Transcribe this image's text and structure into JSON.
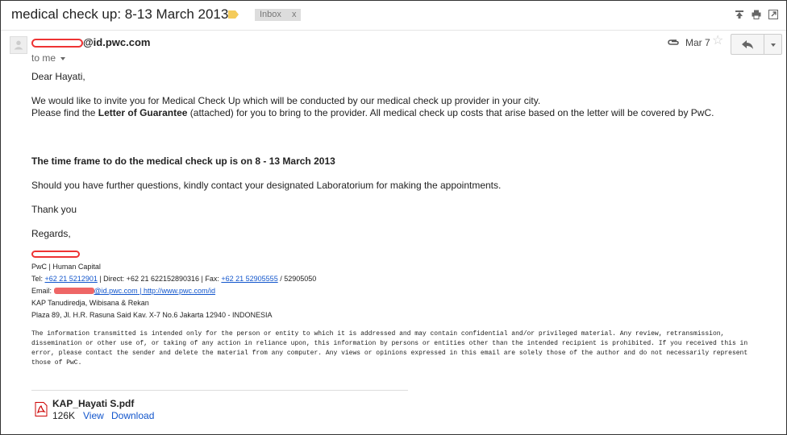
{
  "subject": "medical check up: 8-13 March 2013",
  "label_chip": {
    "text": "Inbox",
    "close": "x"
  },
  "sender": {
    "email_domain": "@id.pwc.com"
  },
  "to_me": "to me",
  "date": "Mar 7",
  "body": {
    "greeting": "Dear Hayati,",
    "para1_line1": "We would like to invite you for Medical Check Up which will be conducted by our medical check up provider in your city.",
    "para1_line2_pre": "Please find the ",
    "para1_line2_bold": "Letter of Guarantee",
    "para1_line2_post": " (attached) for you to bring to the provider. All medical check up costs that arise based on the letter will be covered by PwC.",
    "timeframe": "The time frame to do the medical check up is on 8 - 13 March 2013",
    "questions": "Should you have further questions, kindly contact  your designated Laboratorium  for making the appointments.",
    "thanks": "Thank you",
    "regards": "Regards,"
  },
  "signature": {
    "dept": "PwC | Human Capital",
    "tel_label": "Tel: ",
    "tel_link": "+62 21 5212901",
    "direct": " | Direct: +62 21 622152890316 | Fax: ",
    "fax_link": "+62 21 52905555",
    "fax_tail": " / 52905050",
    "email_label": "Email: ",
    "email_link": "@id.pwc.com",
    "sep": " | ",
    "web_link": "http://www.pwc.com/id",
    "firm": "KAP Tanudiredja, Wibisana & Rekan",
    "address": "Plaza 89, Jl. H.R. Rasuna Said Kav. X-7 No.6 Jakarta 12940 - INDONESIA"
  },
  "disclaimer": "The information transmitted is intended only for the person or entity to which it is addressed and may contain confidential and/or privileged material. Any review, retransmission, dissemination or other use of, or taking of any action in reliance upon, this information by persons or entities other than the intended recipient is prohibited. If you received this in error, please contact the sender and delete the material from any computer. Any views or opinions expressed in this email are solely those of the author and do not necessarily represent those of PwC.",
  "attachment": {
    "name": "KAP_Hayati S.pdf",
    "size": "126K",
    "view": "View",
    "download": "Download"
  },
  "colors": {
    "link": "#1155cc",
    "redaction": "#e33333"
  }
}
